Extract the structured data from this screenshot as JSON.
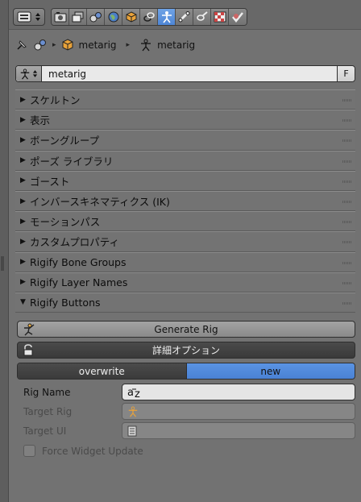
{
  "header": {
    "tabs": [
      {
        "icon": "render-icon"
      },
      {
        "icon": "render-layers-icon"
      },
      {
        "icon": "scene-icon"
      },
      {
        "icon": "world-icon"
      },
      {
        "icon": "object-icon"
      },
      {
        "icon": "constraints-icon"
      },
      {
        "icon": "armature-data-icon",
        "active": true
      },
      {
        "icon": "bone-icon"
      },
      {
        "icon": "bone-constraints-icon"
      },
      {
        "icon": "texture-icon"
      },
      {
        "icon": "material-icon"
      }
    ]
  },
  "breadcrumb": {
    "object_name": "metarig",
    "data_name": "metarig"
  },
  "data_field": {
    "value": "metarig",
    "fake_user": "F"
  },
  "panels": [
    {
      "label": "スケルトン",
      "expanded": false
    },
    {
      "label": "表示",
      "expanded": false
    },
    {
      "label": "ボーングループ",
      "expanded": false
    },
    {
      "label": "ポーズ ライブラリ",
      "expanded": false
    },
    {
      "label": "ゴースト",
      "expanded": false
    },
    {
      "label": "インバースキネマティクス (IK)",
      "expanded": false
    },
    {
      "label": "モーションパス",
      "expanded": false
    },
    {
      "label": "カスタムプロパティ",
      "expanded": false
    },
    {
      "label": "Rigify Bone Groups",
      "expanded": false
    },
    {
      "label": "Rigify Layer Names",
      "expanded": false
    },
    {
      "label": "Rigify Buttons",
      "expanded": true
    }
  ],
  "rigify": {
    "generate_label": "Generate Rig",
    "advanced_label": "詳細オプション",
    "mode_options": [
      "overwrite",
      "new"
    ],
    "mode_selected": "new",
    "rig_name_label": "Rig Name",
    "target_rig_label": "Target Rig",
    "target_ui_label": "Target UI",
    "force_widget_label": "Force Widget Update",
    "force_widget_checked": false
  },
  "colors": {
    "accent": "#5a93e3",
    "background": "#727272"
  }
}
